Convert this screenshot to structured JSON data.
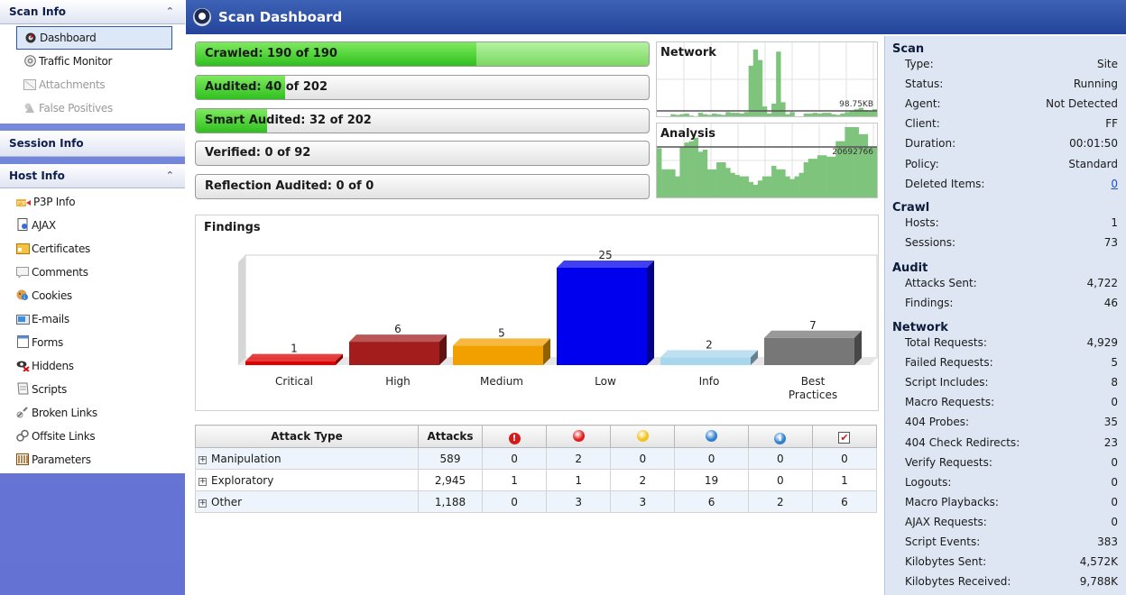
{
  "sidebar": {
    "scan_info": {
      "header": "Scan Info",
      "items": [
        {
          "label": "Dashboard",
          "icon": "dashboard-icon"
        },
        {
          "label": "Traffic Monitor",
          "icon": "traffic-monitor-icon"
        },
        {
          "label": "Attachments",
          "icon": "attachments-icon"
        },
        {
          "label": "False Positives",
          "icon": "false-positives-icon"
        }
      ]
    },
    "session_info": {
      "header": "Session Info"
    },
    "host_info": {
      "header": "Host Info",
      "items": [
        {
          "label": "P3P Info",
          "icon": "p3p-icon"
        },
        {
          "label": "AJAX",
          "icon": "ajax-icon"
        },
        {
          "label": "Certificates",
          "icon": "certificates-icon"
        },
        {
          "label": "Comments",
          "icon": "comments-icon"
        },
        {
          "label": "Cookies",
          "icon": "cookies-icon"
        },
        {
          "label": "E-mails",
          "icon": "emails-icon"
        },
        {
          "label": "Forms",
          "icon": "forms-icon"
        },
        {
          "label": "Hiddens",
          "icon": "hiddens-icon"
        },
        {
          "label": "Scripts",
          "icon": "scripts-icon"
        },
        {
          "label": "Broken Links",
          "icon": "broken-links-icon"
        },
        {
          "label": "Offsite Links",
          "icon": "offsite-links-icon"
        },
        {
          "label": "Parameters",
          "icon": "parameters-icon"
        }
      ]
    }
  },
  "header": {
    "title": "Scan Dashboard"
  },
  "progress": [
    {
      "label": "Crawled: 190 of 190",
      "fraction": 1.0,
      "secondary_fraction": 1.0
    },
    {
      "label": "Audited: 40 of 202",
      "fraction": 0.198
    },
    {
      "label": "Smart Audited: 32 of 202",
      "fraction": 0.158
    },
    {
      "label": "Verified: 0 of 92",
      "fraction": 0.0
    },
    {
      "label": "Reflection Audited: 0 of 0",
      "fraction": 0.0
    }
  ],
  "network_graph": {
    "title": "Network",
    "value_label": "98.75KB",
    "bars": [
      0,
      0,
      0,
      3,
      2,
      3,
      4,
      1,
      0,
      5,
      3,
      2,
      4,
      3,
      2,
      6,
      5,
      5,
      4,
      6,
      72,
      95,
      80,
      14,
      4,
      18,
      92,
      20,
      3,
      6,
      0,
      0,
      4,
      4,
      5,
      4,
      5,
      5,
      3,
      2,
      4,
      6,
      8,
      10,
      12,
      9,
      8,
      10
    ]
  },
  "analysis_graph": {
    "title": "Analysis",
    "value_label": "20692766",
    "bars": [
      70,
      40,
      40,
      40,
      30,
      72,
      78,
      80,
      85,
      65,
      68,
      40,
      40,
      50,
      50,
      42,
      35,
      32,
      30,
      30,
      22,
      18,
      24,
      30,
      30,
      45,
      40,
      40,
      30,
      26,
      30,
      35,
      50,
      55,
      55,
      60,
      60,
      58,
      58,
      80,
      80,
      100,
      100,
      100,
      90,
      90,
      72,
      72
    ]
  },
  "findings": {
    "title": "Findings",
    "chart_data": {
      "type": "bar",
      "categories": [
        "Critical",
        "High",
        "Medium",
        "Low",
        "Info",
        "Best Practices"
      ],
      "values": [
        1,
        6,
        5,
        25,
        2,
        7
      ],
      "colors": [
        "#e00000",
        "#a31d1d",
        "#f2a000",
        "#0000ee",
        "#a8d6ec",
        "#777777"
      ],
      "ylim": [
        0,
        25
      ]
    }
  },
  "attack_table": {
    "headers": {
      "type": "Attack Type",
      "attacks": "Attacks"
    },
    "severity_icons": [
      {
        "name": "critical-severity-icon",
        "color": "#d61a1a"
      },
      {
        "name": "high-severity-icon",
        "color": "#e01b1b"
      },
      {
        "name": "medium-severity-icon",
        "color": "#f0c419"
      },
      {
        "name": "low-severity-icon",
        "color": "#2f7fd1"
      },
      {
        "name": "info-severity-icon",
        "color": "#2f7fd1"
      },
      {
        "name": "best-practice-icon",
        "color": "#d61a1a"
      }
    ],
    "rows": [
      {
        "type": "Manipulation",
        "attacks": "589",
        "counts": [
          "0",
          "2",
          "0",
          "0",
          "0",
          "0"
        ]
      },
      {
        "type": "Exploratory",
        "attacks": "2,945",
        "counts": [
          "1",
          "1",
          "2",
          "19",
          "0",
          "1"
        ]
      },
      {
        "type": "Other",
        "attacks": "1,188",
        "counts": [
          "0",
          "3",
          "3",
          "6",
          "2",
          "6"
        ]
      }
    ]
  },
  "right_panel": {
    "scan": {
      "title": "Scan",
      "rows": [
        {
          "k": "Type:",
          "v": "Site"
        },
        {
          "k": "Status:",
          "v": "Running"
        },
        {
          "k": "Agent:",
          "v": "Not Detected"
        },
        {
          "k": "Client:",
          "v": "FF"
        },
        {
          "k": "Duration:",
          "v": "00:01:50"
        },
        {
          "k": "Policy:",
          "v": "Standard"
        },
        {
          "k": "Deleted Items:",
          "v": "0",
          "link": true
        }
      ]
    },
    "crawl": {
      "title": "Crawl",
      "rows": [
        {
          "k": "Hosts:",
          "v": "1"
        },
        {
          "k": "Sessions:",
          "v": "73"
        }
      ]
    },
    "audit": {
      "title": "Audit",
      "rows": [
        {
          "k": "Attacks Sent:",
          "v": "4,722"
        },
        {
          "k": "Findings:",
          "v": "46"
        }
      ]
    },
    "network": {
      "title": "Network",
      "rows": [
        {
          "k": "Total Requests:",
          "v": "4,929"
        },
        {
          "k": "Failed Requests:",
          "v": "5"
        },
        {
          "k": "Script Includes:",
          "v": "8"
        },
        {
          "k": "Macro Requests:",
          "v": "0"
        },
        {
          "k": "404 Probes:",
          "v": "35"
        },
        {
          "k": "404 Check Redirects:",
          "v": "23"
        },
        {
          "k": "Verify Requests:",
          "v": "0"
        },
        {
          "k": "Logouts:",
          "v": "0"
        },
        {
          "k": "Macro Playbacks:",
          "v": "0"
        },
        {
          "k": "AJAX Requests:",
          "v": "0"
        },
        {
          "k": "Script Events:",
          "v": "383"
        },
        {
          "k": "Kilobytes Sent:",
          "v": "4,572K"
        },
        {
          "k": "Kilobytes Received:",
          "v": "9,788K"
        }
      ]
    }
  }
}
